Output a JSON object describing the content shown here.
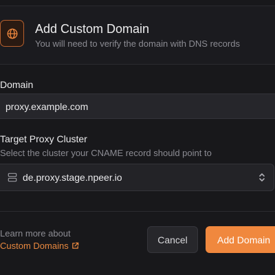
{
  "header": {
    "title": "Add Custom Domain",
    "subtitle": "You will need to verify the domain with DNS records",
    "icon": "globe-icon"
  },
  "domain_field": {
    "label": "Domain",
    "value": "proxy.example.com"
  },
  "cluster_field": {
    "label": "Target Proxy Cluster",
    "help": "Select the cluster your CNAME record should point to",
    "selected": "de.proxy.stage.npeer.io",
    "icon": "server-icon"
  },
  "footer": {
    "learn_more": "Learn more about",
    "link_text": "Custom Domains",
    "cancel_label": "Cancel",
    "add_label": "Add Domain"
  },
  "colors": {
    "accent": "#f0883e",
    "background": "#18181b"
  }
}
